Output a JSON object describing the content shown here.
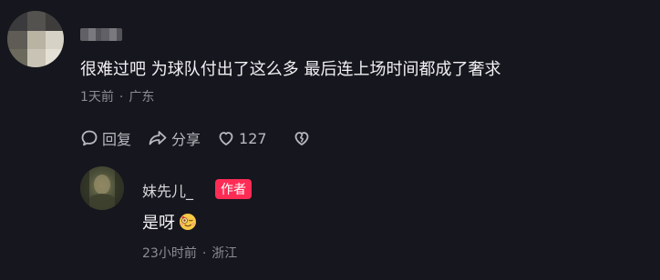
{
  "comment": {
    "text": "很难过吧 为球队付出了这么多 最后连上场时间都成了奢求",
    "time": "1天前",
    "location": "广东",
    "actions": {
      "reply_label": "回复",
      "share_label": "分享",
      "like_count": "127"
    }
  },
  "reply": {
    "username": "妹先儿_",
    "badge": "作者",
    "text": "是呀",
    "emoji": "flirty-wink-emoji",
    "time": "23小时前",
    "location": "浙江"
  },
  "colors": {
    "background": "#16161e",
    "badge": "#fe2c55",
    "meta_text": "#8c8c94"
  }
}
